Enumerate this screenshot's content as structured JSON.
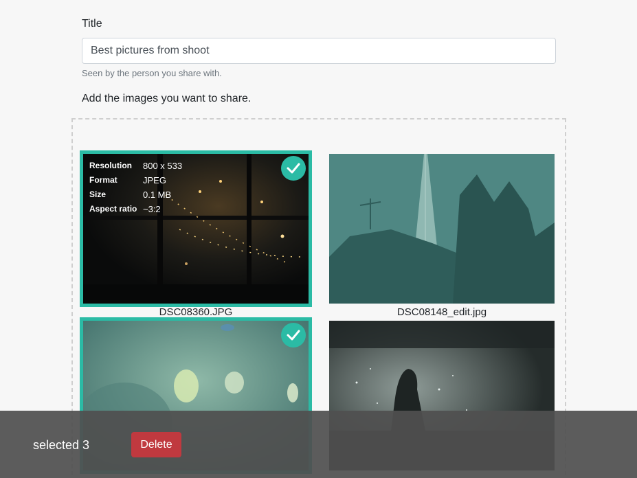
{
  "form": {
    "title_label": "Title",
    "title_value": "Best pictures from shoot",
    "title_help": "Seen by the person you share with.",
    "add_images_label": "Add the images you want to share."
  },
  "images": [
    {
      "filename": "DSC08360.JPG",
      "selected": true,
      "meta": [
        {
          "key": "Resolution",
          "value": "800 x 533"
        },
        {
          "key": "Format",
          "value": "JPEG"
        },
        {
          "key": "Size",
          "value": "0.1 MB"
        },
        {
          "key": "Aspect ratio",
          "value": "~3:2"
        }
      ]
    },
    {
      "filename": "DSC08148_edit.jpg",
      "selected": false
    },
    {
      "filename": "",
      "selected": true
    },
    {
      "filename": "",
      "selected": false
    }
  ],
  "selection_bar": {
    "count_text": "selected 3",
    "delete_label": "Delete"
  },
  "colors": {
    "selection_accent": "#2bbba5",
    "delete_button": "#c0393f"
  }
}
